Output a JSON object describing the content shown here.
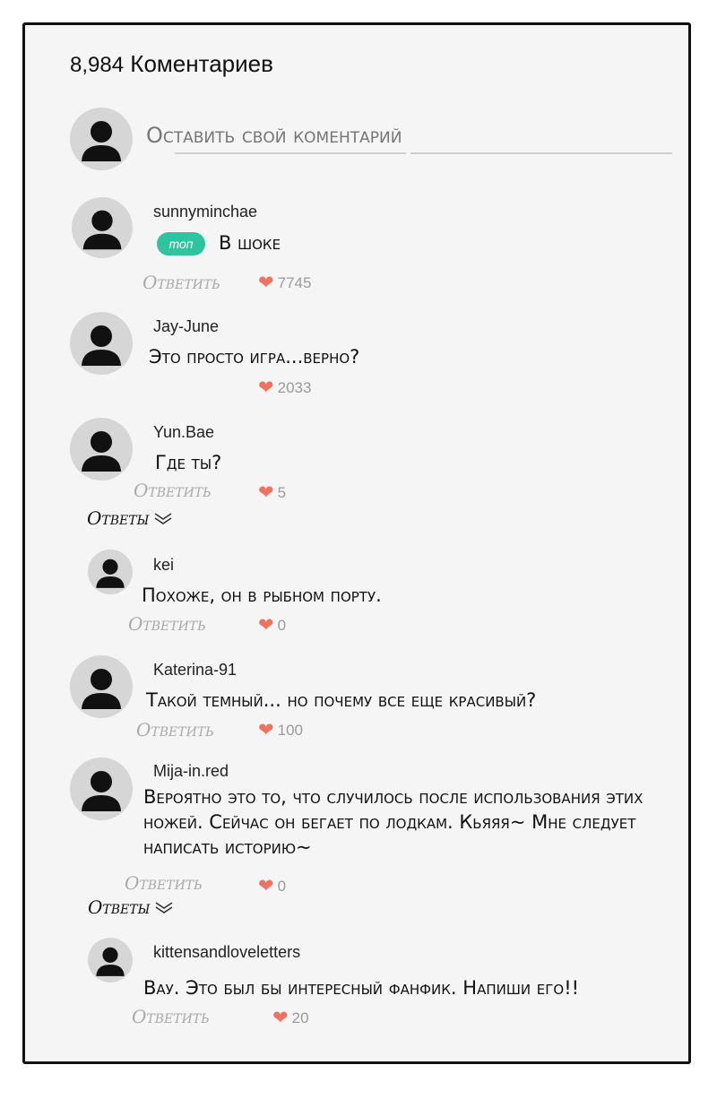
{
  "header": {
    "count": "8,984",
    "title": "Коментариев"
  },
  "compose": {
    "placeholder": "Оставить свой коментарий"
  },
  "reply_label": "Ответить",
  "replies_label": "Ответы",
  "colors": {
    "accent_badge": "#2ec4a0",
    "heart": "#f07261",
    "muted": "#a9a9a9"
  },
  "comments": [
    {
      "username": "sunnyminchae",
      "badge": "топ",
      "text": "В шоке",
      "likes": "7745"
    },
    {
      "username": "Jay-June",
      "text": "Это просто игра...верно?",
      "likes": "2033"
    },
    {
      "username": "Yun.Bae",
      "text": "Где ты?",
      "likes": "5",
      "replies": [
        {
          "username": "kei",
          "text": "Похоже, он в рыбном порту.",
          "likes": "0"
        }
      ]
    },
    {
      "username": "Katerina-91",
      "text": "Такой темный... но почему все еще красивый?",
      "likes": "100"
    },
    {
      "username": "Mija-in.red",
      "text": "Вероятно это то, что случилось после использования этих ножей. Сейчас он бегает по лодкам. Кьяяя~ Мне следует написать историю~",
      "likes": "0",
      "replies": [
        {
          "username": "kittensandloveletters",
          "text": "Вау. Это был бы интересный фанфик. Напиши его!!",
          "likes": "20"
        }
      ]
    }
  ]
}
